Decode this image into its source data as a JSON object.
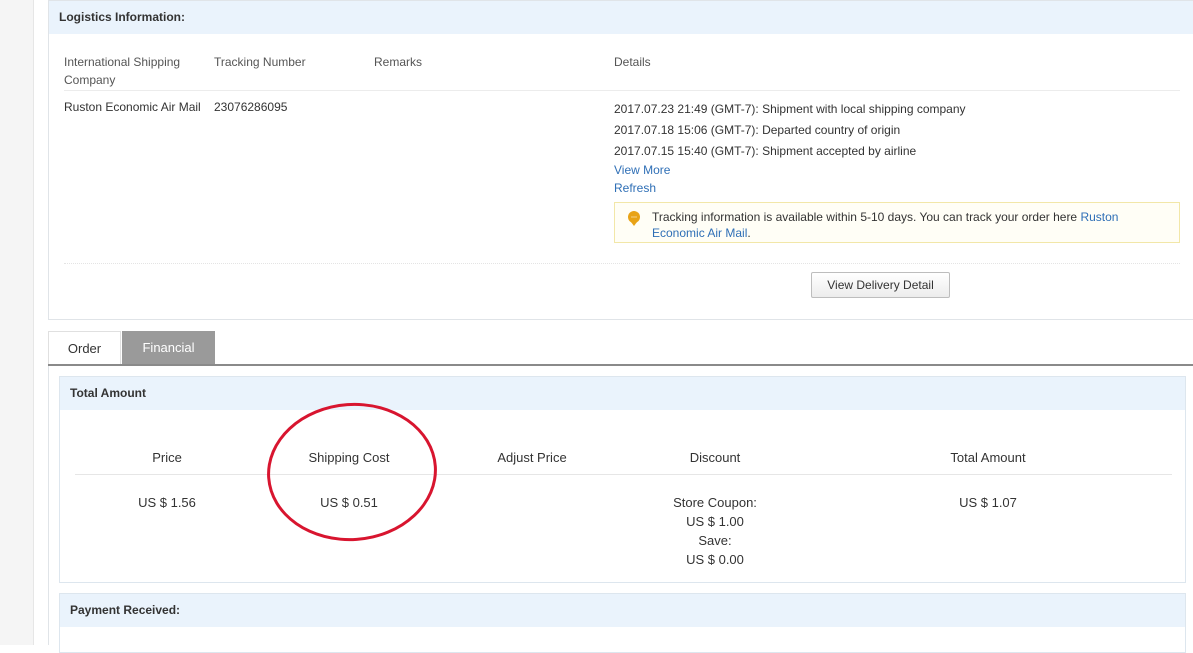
{
  "logistics": {
    "title": "Logistics Information:",
    "columns": {
      "company": "International Shipping Company",
      "tracking": "Tracking Number",
      "remarks": "Remarks",
      "details": "Details"
    },
    "row": {
      "company": "Ruston Economic Air Mail",
      "tracking_number": "23076286095",
      "remarks": ""
    },
    "events": [
      "2017.07.23 21:49 (GMT-7): Shipment with local shipping company",
      "2017.07.18 15:06 (GMT-7): Departed country of origin",
      "2017.07.15 15:40 (GMT-7): Shipment accepted by airline"
    ],
    "view_more": "View More",
    "refresh": "Refresh",
    "tip": {
      "text": "Tracking information is available within 5-10 days. You can track your order here ",
      "link": "Ruston Economic Air Mail",
      "suffix": ".",
      "icon": "bulb-icon"
    },
    "view_delivery_detail": "View Delivery Detail"
  },
  "tabs": [
    {
      "label": "Order",
      "active": false
    },
    {
      "label": "Financial",
      "active": true
    }
  ],
  "total_amount": {
    "title": "Total Amount",
    "headers": {
      "price": "Price",
      "shipping": "Shipping Cost",
      "adjust": "Adjust Price",
      "discount": "Discount",
      "total": "Total Amount"
    },
    "values": {
      "price": "US $ 1.56",
      "shipping": "US $ 0.51",
      "adjust": "",
      "discount_lines": [
        "Store Coupon:",
        "US $ 1.00",
        "Save:",
        "US $ 0.00"
      ],
      "total": "US $ 1.07"
    }
  },
  "payment": {
    "title": "Payment Received:"
  },
  "colors": {
    "header_bg": "#eaf3fc",
    "link": "#2f6fb6",
    "active_tab": "#9a9a9a",
    "annotation": "#d8152f"
  }
}
